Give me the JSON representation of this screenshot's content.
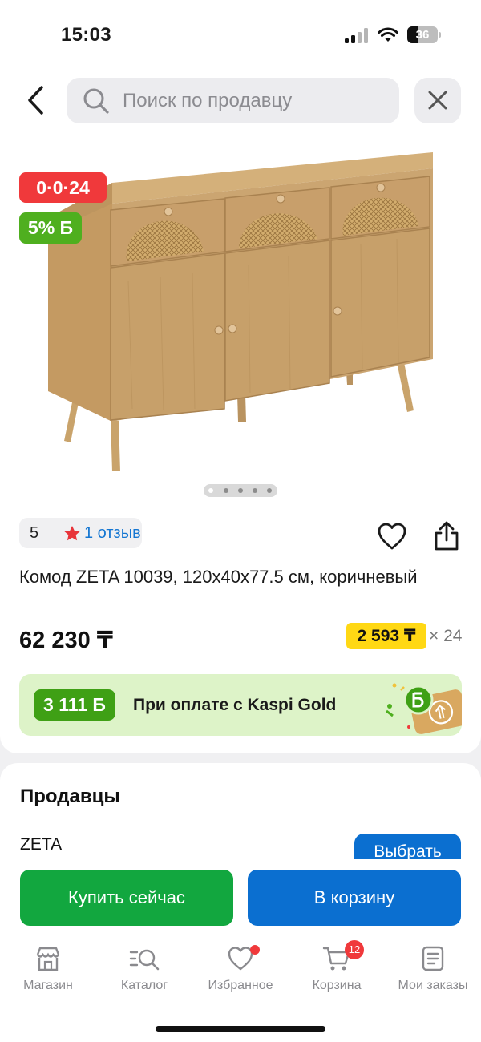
{
  "status_bar": {
    "time": "15:03",
    "battery": "36",
    "battery_level": 0.36
  },
  "search": {
    "placeholder": "Поиск по продавцу"
  },
  "product": {
    "installment_badge": "0·0·24",
    "bonus_badge": "5% Б",
    "image_count": 5,
    "active_image": 1,
    "rating": "5",
    "reviews": "1 отзыв",
    "title": "Комод ZETA 10039, 120х40х77.5 см, коричневый",
    "price": "62 230 ₸",
    "monthly_payment": "2 593 ₸",
    "months": "× 24"
  },
  "kaspi_gold": {
    "bonus": "3 111 Б",
    "text": "При оплате с Kaspi Gold"
  },
  "sellers": {
    "title": "Продавцы",
    "items": [
      {
        "name": "ZETA",
        "button": "Выбрать"
      }
    ]
  },
  "actions": {
    "buy_now": "Купить сейчас",
    "add_to_cart": "В корзину"
  },
  "bottom_nav": {
    "items": [
      {
        "label": "Магазин",
        "icon": "store-icon"
      },
      {
        "label": "Каталог",
        "icon": "catalog-search-icon"
      },
      {
        "label": "Избранное",
        "icon": "heart-icon"
      },
      {
        "label": "Корзина",
        "icon": "cart-icon",
        "badge": "12"
      },
      {
        "label": "Мои заказы",
        "icon": "orders-icon"
      }
    ]
  },
  "colors": {
    "primary_blue": "#0b6fd0",
    "buy_green": "#12a73f",
    "sale_red": "#f0393b",
    "bonus_green": "#4faf1f",
    "installment_yellow": "#ffd814"
  }
}
